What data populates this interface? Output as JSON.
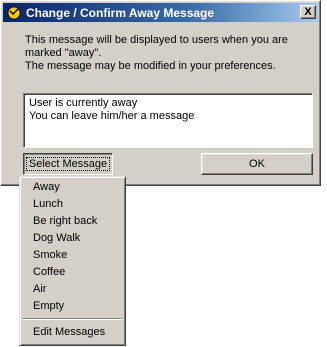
{
  "dialog": {
    "title": "Change / Confirm Away Message",
    "close_label": "X",
    "description": [
      "This message will be displayed to users when you are",
      "marked \"away\".",
      "The message may be modified in your preferences."
    ],
    "message": [
      "User is currently away",
      "You can leave him/her a message"
    ],
    "select_button": "Select Message",
    "ok_button": "OK"
  },
  "menu": {
    "items": [
      "Away",
      "Lunch",
      "Be right back",
      "Dog Walk",
      "Smoke",
      "Coffee",
      "Air",
      "Empty"
    ],
    "footer_item": "Edit Messages"
  }
}
